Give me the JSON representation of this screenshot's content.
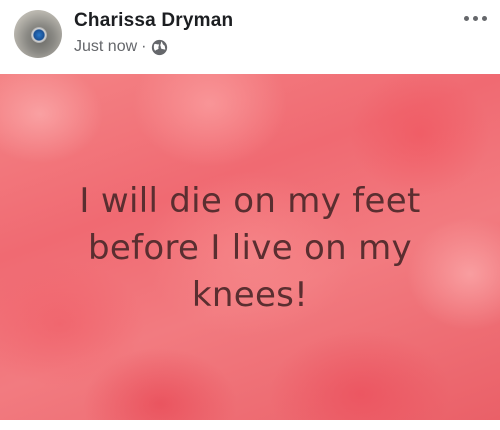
{
  "post": {
    "author_name": "Charissa Dryman",
    "timestamp": "Just now",
    "separator": "·",
    "privacy_icon": "globe-icon",
    "more_icon": "more-options-icon",
    "text": "I will die on my feet before I live on my knees!",
    "background_colors": [
      "#f48486",
      "#f06a72",
      "#ea6068"
    ],
    "text_color": "#5a2e30"
  }
}
